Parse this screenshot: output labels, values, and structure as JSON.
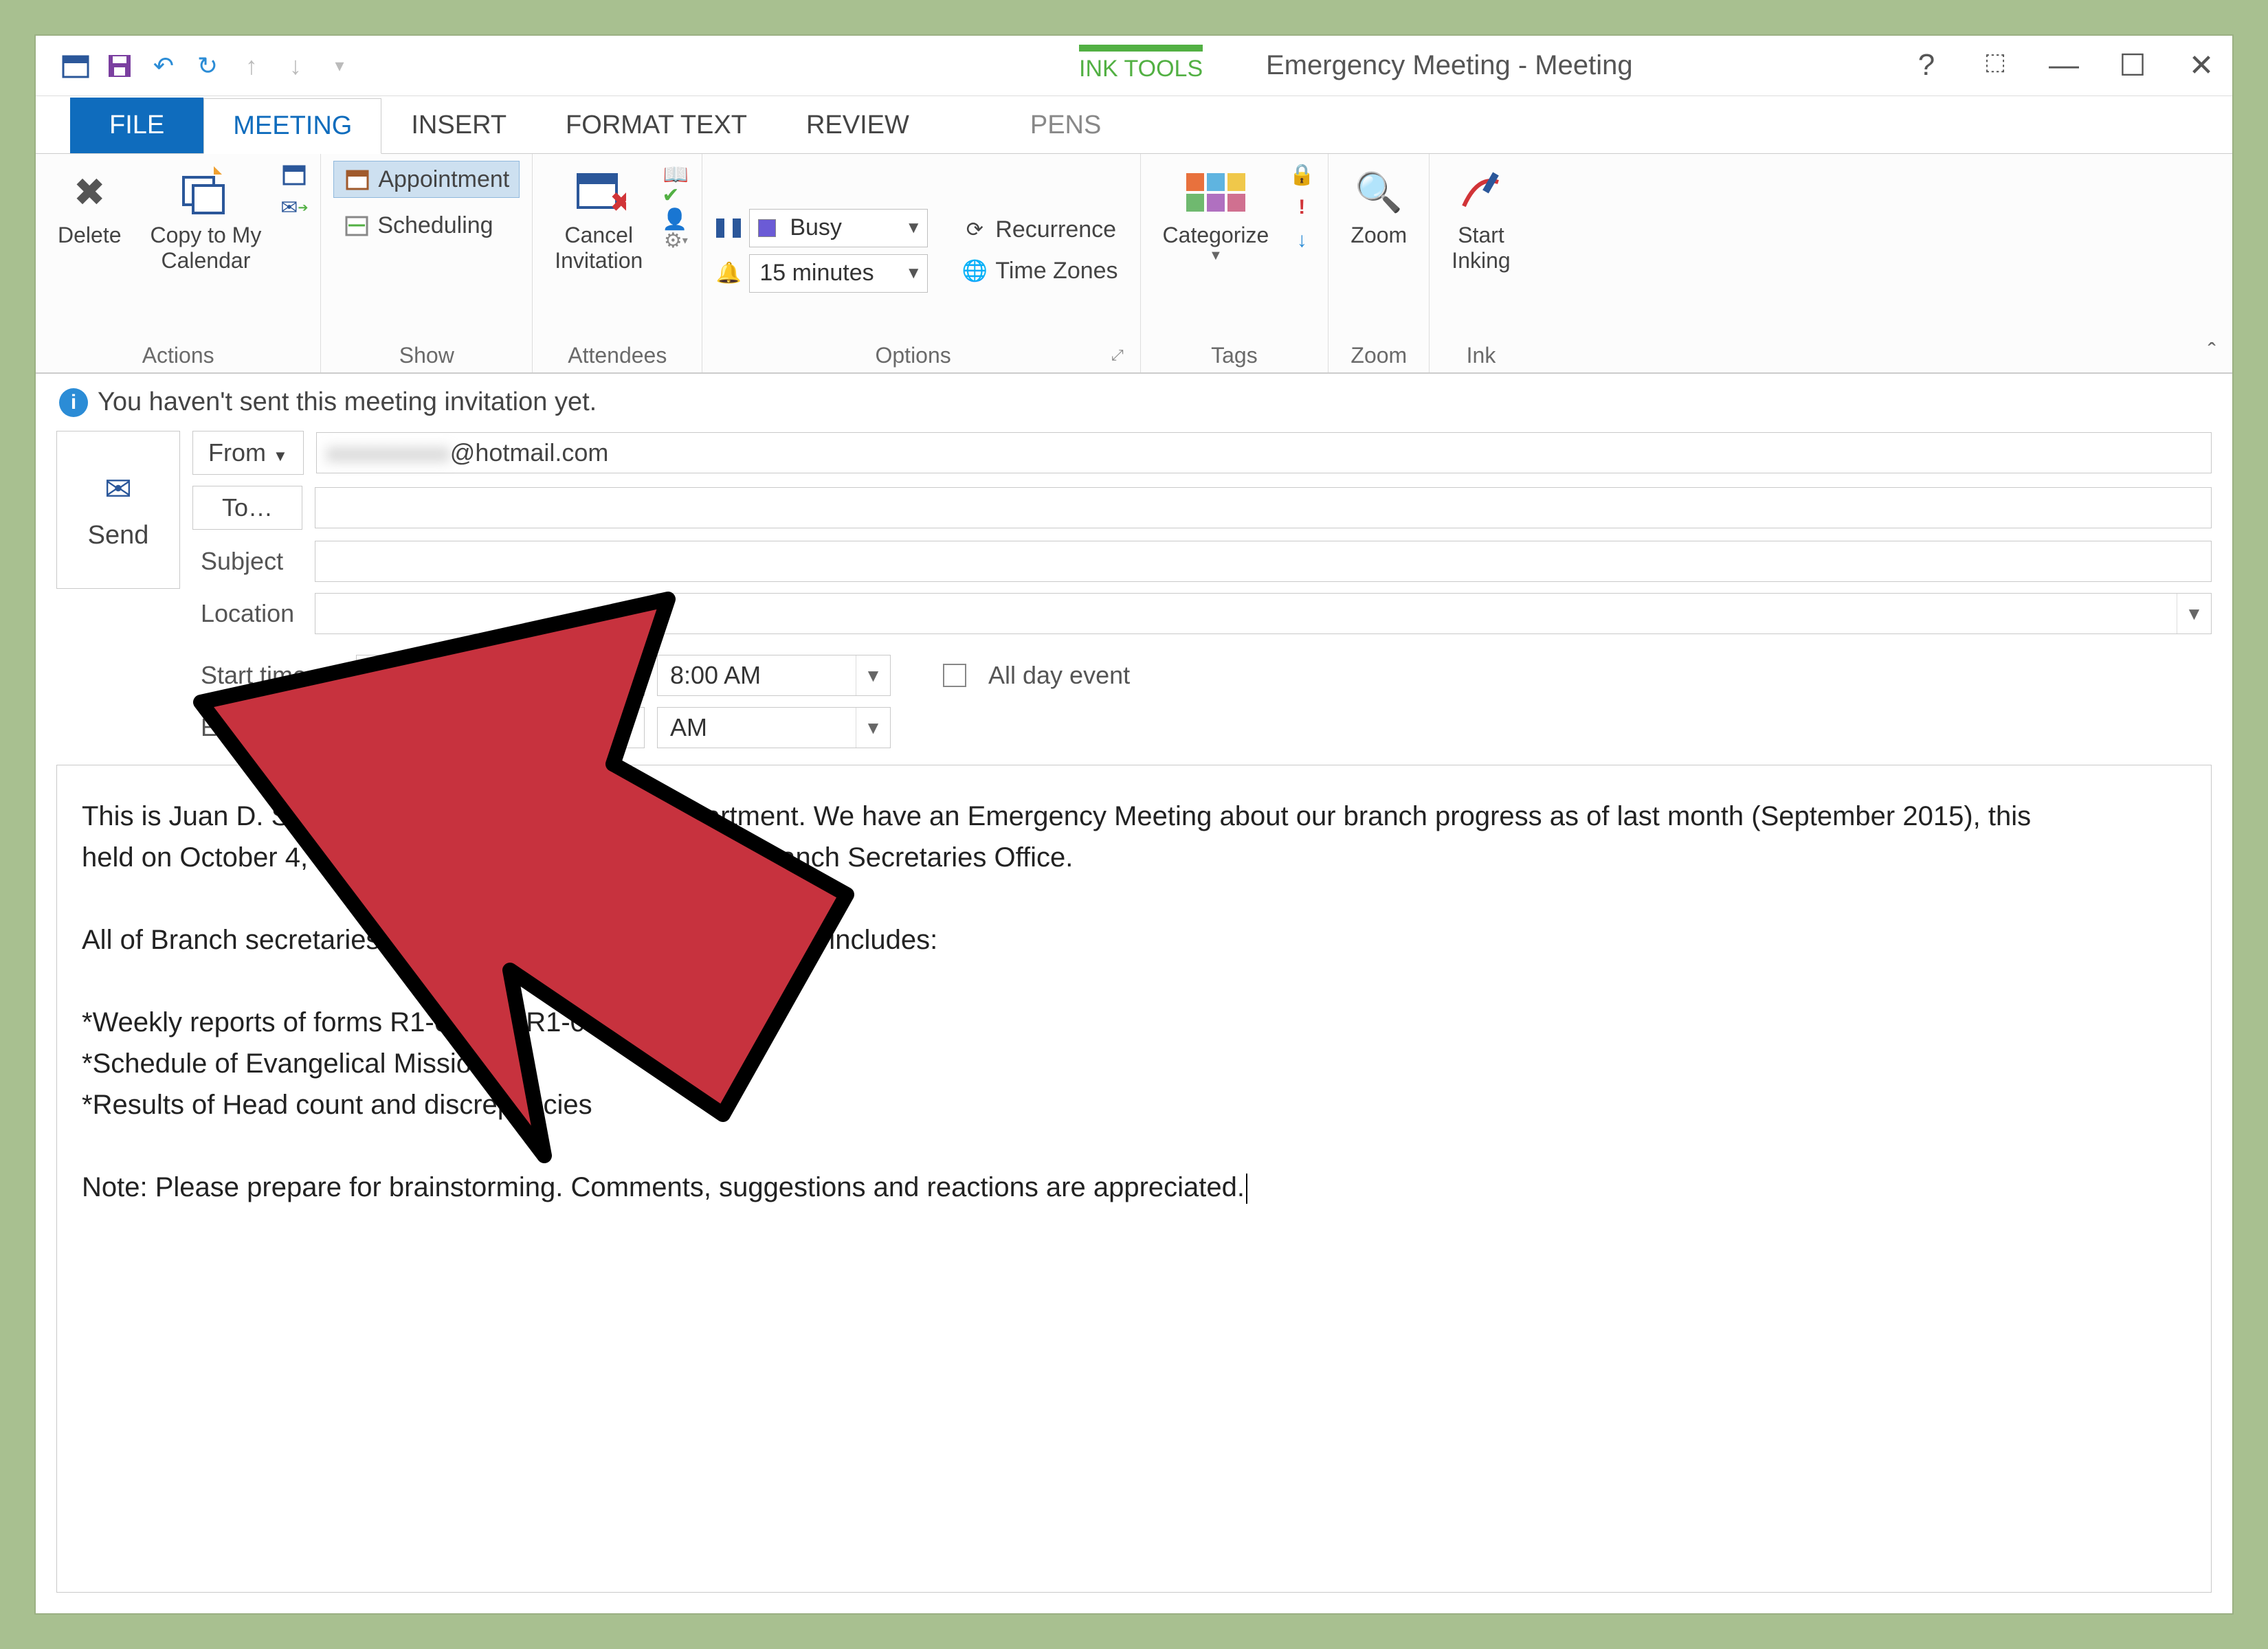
{
  "title": "Emergency Meeting - Meeting",
  "ink_tools_label": "INK TOOLS",
  "tabs": {
    "file": "FILE",
    "meeting": "MEETING",
    "insert": "INSERT",
    "format_text": "FORMAT TEXT",
    "review": "REVIEW",
    "pens": "PENS"
  },
  "ribbon": {
    "actions": {
      "label": "Actions",
      "delete": "Delete",
      "copy_to_my": "Copy to My\nCalendar"
    },
    "show": {
      "label": "Show",
      "appointment": "Appointment",
      "scheduling": "Scheduling"
    },
    "attendees": {
      "label": "Attendees",
      "cancel_invitation": "Cancel\nInvitation"
    },
    "options": {
      "label": "Options",
      "busy": "Busy",
      "reminder": "15 minutes",
      "recurrence": "Recurrence",
      "time_zones": "Time Zones"
    },
    "tags": {
      "label": "Tags",
      "categorize": "Categorize"
    },
    "zoom": {
      "label": "Zoom",
      "zoom": "Zoom"
    },
    "ink": {
      "label": "Ink",
      "start_inking": "Start\nInking"
    }
  },
  "infobar": "You haven't sent this meeting invitation yet.",
  "send": "Send",
  "fields": {
    "from_label": "From",
    "from_value": "@hotmail.com",
    "to_label": "To…",
    "subject_label": "Subject",
    "location_label": "Location",
    "start_label": "Start time",
    "end_label": "End time",
    "start_time": "8:00 AM",
    "end_time": "AM",
    "allday": "All day event"
  },
  "body": "This is Juan D. Smith Local Se               f KHM Department. We have an Emergency Meeting about our branch progress as of last month (September 2015), this                held on October 4, 2015 at 5:30 in the afternoon at our Branch Secretaries Office.\n\nAll of Branch secretaries are expected to attend, Our agenda includes:\n\n*Weekly reports of forms R1-05 and R1-03.\n*Schedule of Evangelical Missions.\n*Results of Head count and discrepancies\n\nNote: Please prepare for brainstorming. Comments, suggestions and reactions are appreciated."
}
